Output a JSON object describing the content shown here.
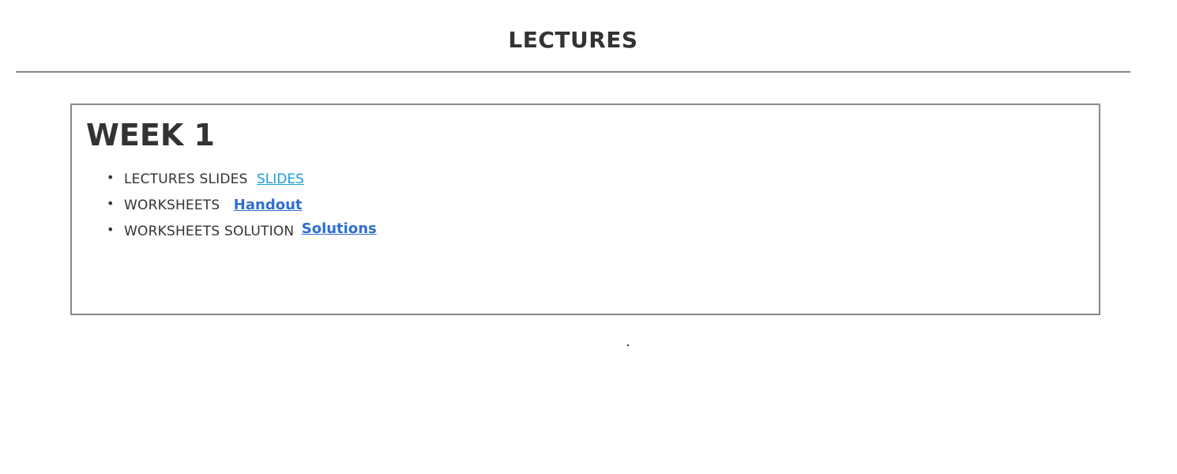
{
  "page": {
    "title": "LECTURES"
  },
  "week": {
    "heading": "WEEK 1",
    "items": [
      {
        "label": "LECTURES SLIDES",
        "link_text": "SLIDES"
      },
      {
        "label": "WORKSHEETS",
        "link_text": "Handout"
      },
      {
        "label": "WORKSHEETS SOLUTION",
        "link_text": "Solutions"
      }
    ]
  },
  "colors": {
    "text": "#333333",
    "rule": "#8a8a8a",
    "link_slides": "#1a9bd7",
    "link_handout": "#2f6fcf"
  }
}
